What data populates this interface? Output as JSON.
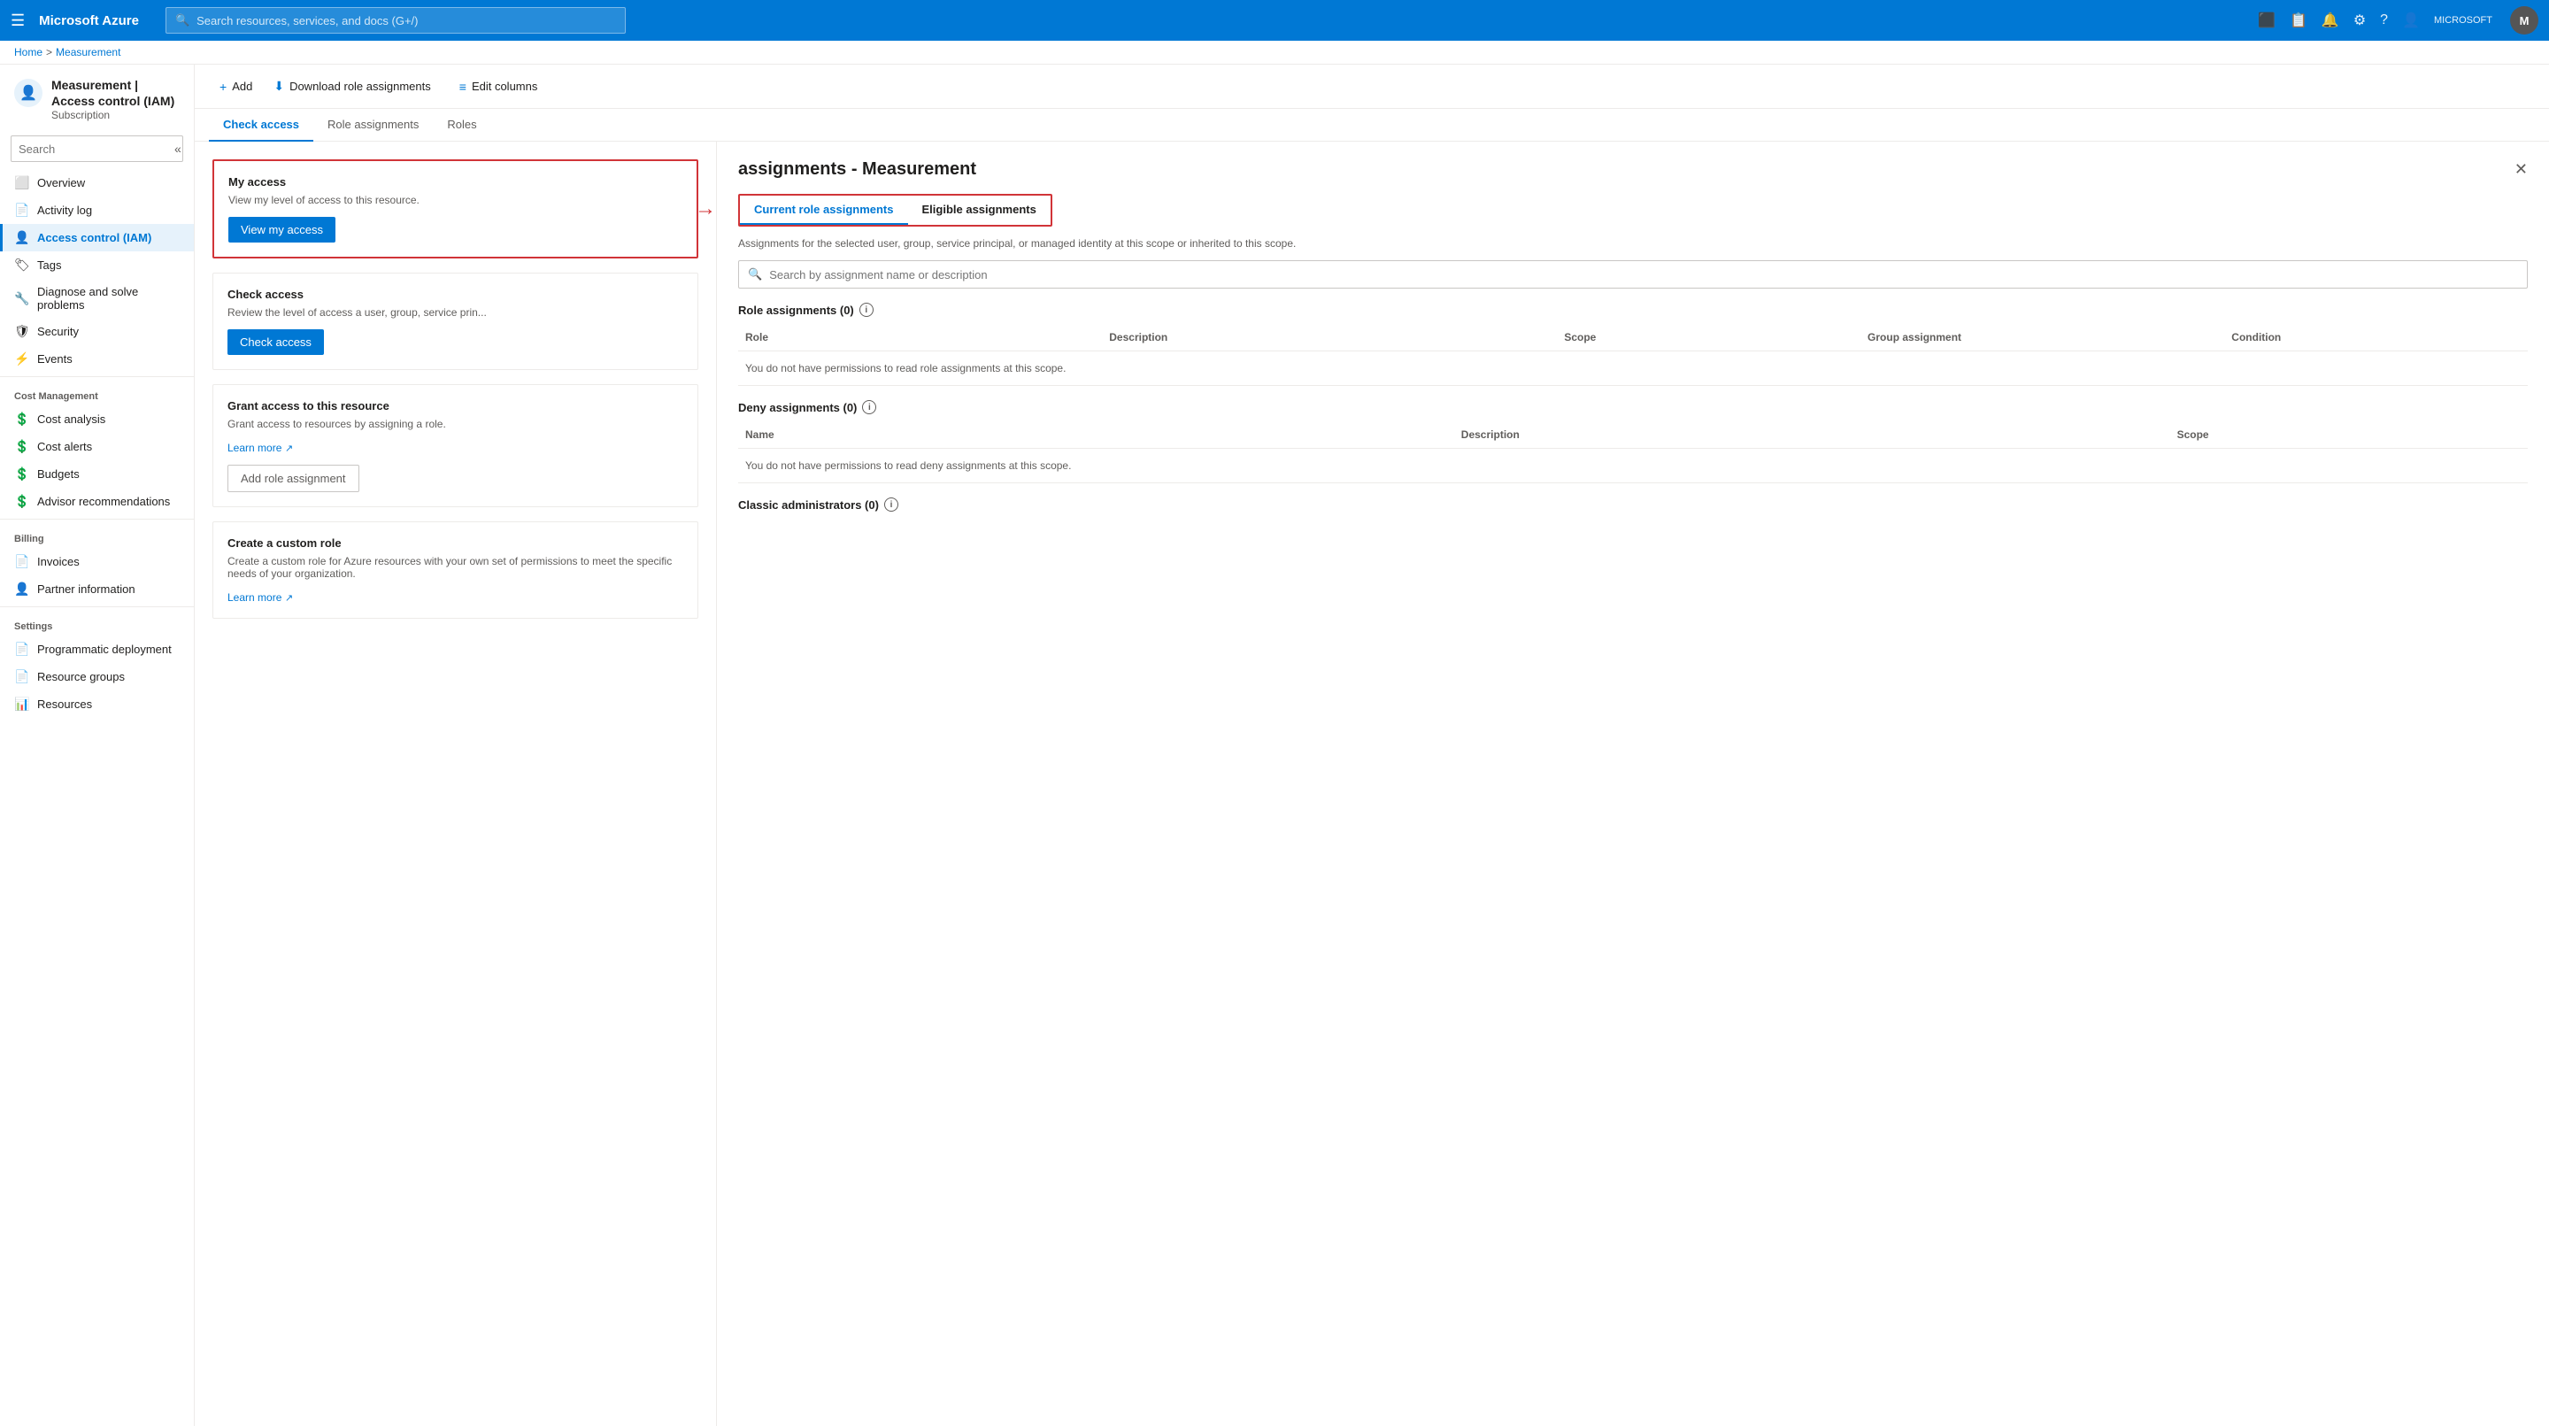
{
  "topbar": {
    "hamburger": "☰",
    "logo": "Microsoft Azure",
    "search_placeholder": "Search resources, services, and docs (G+/)",
    "username": "MICROSOFT",
    "icons": {
      "portal": "⬛",
      "feedback": "📋",
      "bell": "🔔",
      "settings": "⚙",
      "help": "?",
      "user": "👤"
    }
  },
  "breadcrumb": {
    "home": "Home",
    "separator1": ">",
    "resource": "Measurement"
  },
  "sidebar": {
    "icon": "👤",
    "title": "Measurement | Access control (IAM)",
    "subtitle": "Subscription",
    "search_placeholder": "Search",
    "collapse_title": "«",
    "items": [
      {
        "id": "overview",
        "label": "Overview",
        "icon": "⬜",
        "active": false
      },
      {
        "id": "activity-log",
        "label": "Activity log",
        "icon": "📄",
        "active": false
      },
      {
        "id": "iam",
        "label": "Access control (IAM)",
        "icon": "👤",
        "active": true
      },
      {
        "id": "tags",
        "label": "Tags",
        "icon": "🏷",
        "active": false
      },
      {
        "id": "diagnose",
        "label": "Diagnose and solve problems",
        "icon": "🔧",
        "active": false
      },
      {
        "id": "security",
        "label": "Security",
        "icon": "🛡",
        "active": false
      },
      {
        "id": "events",
        "label": "Events",
        "icon": "⚡",
        "active": false
      }
    ],
    "sections": [
      {
        "label": "Cost Management",
        "items": [
          {
            "id": "cost-analysis",
            "label": "Cost analysis",
            "icon": "💲",
            "active": false
          },
          {
            "id": "cost-alerts",
            "label": "Cost alerts",
            "icon": "💲",
            "active": false
          },
          {
            "id": "budgets",
            "label": "Budgets",
            "icon": "💲",
            "active": false
          },
          {
            "id": "advisor",
            "label": "Advisor recommendations",
            "icon": "💲",
            "active": false
          }
        ]
      },
      {
        "label": "Billing",
        "items": [
          {
            "id": "invoices",
            "label": "Invoices",
            "icon": "📄",
            "active": false
          },
          {
            "id": "partner",
            "label": "Partner information",
            "icon": "👤",
            "active": false
          }
        ]
      },
      {
        "label": "Settings",
        "items": [
          {
            "id": "programmatic",
            "label": "Programmatic deployment",
            "icon": "📄",
            "active": false
          },
          {
            "id": "resource-groups",
            "label": "Resource groups",
            "icon": "📄",
            "active": false
          },
          {
            "id": "resources",
            "label": "Resources",
            "icon": "📊",
            "active": false
          }
        ]
      }
    ]
  },
  "toolbar": {
    "add_label": "Add",
    "download_label": "Download role assignments",
    "columns_label": "Edit columns"
  },
  "tabs": [
    {
      "id": "check-access",
      "label": "Check access",
      "active": true
    },
    {
      "id": "role-assignments",
      "label": "Role assignments",
      "active": false
    },
    {
      "id": "roles",
      "label": "Roles",
      "active": false
    }
  ],
  "cards": {
    "my_access": {
      "title": "My access",
      "description": "View my level of access to this resource.",
      "button": "View my access",
      "highlighted": true
    },
    "check_access": {
      "title": "Check access",
      "description": "Review the level of access a user, group, service prin...",
      "button": "Check access"
    },
    "grant_access": {
      "title": "Grant access to this resource",
      "description": "Grant access to resources by assigning a role.",
      "learn_more": "Learn more",
      "button": "Add role assignment"
    },
    "custom_role": {
      "title": "Create a custom role",
      "description": "Create a custom role for Azure resources with your own set of permissions to meet the specific needs of your organization.",
      "learn_more": "Learn more"
    }
  },
  "right_panel": {
    "title": "assignments - Measurement",
    "close_icon": "✕",
    "tabs": [
      {
        "id": "current",
        "label": "Current role assignments",
        "active": true
      },
      {
        "id": "eligible",
        "label": "Eligible assignments",
        "active": false
      }
    ],
    "description": "Assignments for the selected user, group, service principal, or managed identity at this scope or inherited to this scope.",
    "search_placeholder": "Search by assignment name or description",
    "role_assignments": {
      "title": "Role assignments (0)",
      "info_icon": "i",
      "columns": [
        "Role",
        "Description",
        "Scope",
        "Group assignment",
        "Condition"
      ],
      "empty_message": "You do not have permissions to read role assignments at this scope."
    },
    "deny_assignments": {
      "title": "Deny assignments (0)",
      "info_icon": "i",
      "columns": [
        "Name",
        "Description",
        "Scope"
      ],
      "empty_message": "You do not have permissions to read deny assignments at this scope."
    },
    "classic_admins": {
      "title": "Classic administrators (0)",
      "info_icon": "i"
    }
  }
}
